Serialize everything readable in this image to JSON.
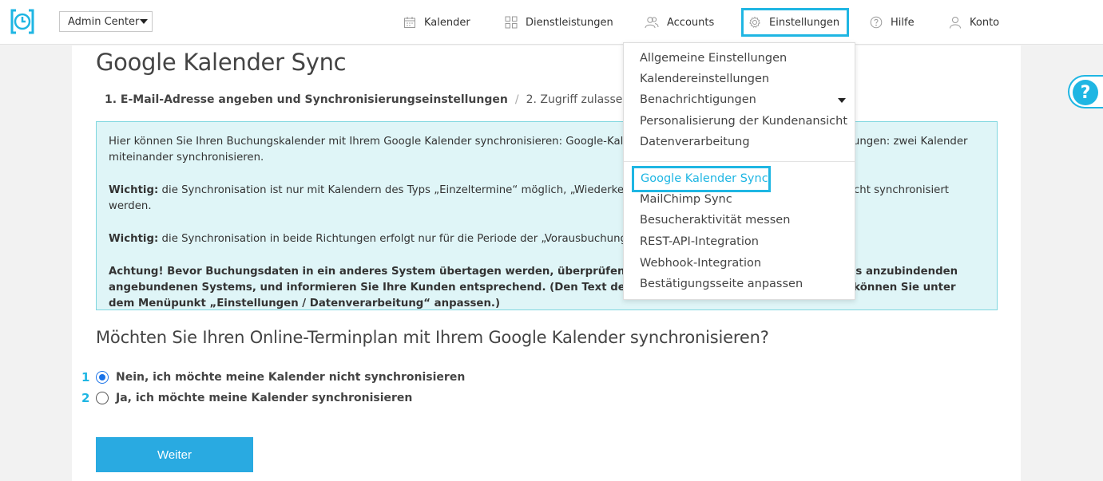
{
  "header": {
    "admin_select": "Admin Center",
    "nav": {
      "kalender": "Kalender",
      "dienstleistungen": "Dienstleistungen",
      "accounts": "Accounts",
      "einstellungen": "Einstellungen",
      "hilfe": "Hilfe",
      "konto": "Konto"
    }
  },
  "page": {
    "title": "Google Kalender Sync",
    "steps": {
      "step1": "1. E-Mail-Adresse angeben und Synchronisierungseinstellungen",
      "separator": "/",
      "step2": "2. Zugriff zulassen"
    },
    "info": {
      "p1": "Hier können Sie Ihren Buchungskalender mit Ihrem Google Kalender synchronisieren: Google-Kalender und Online-Terminplan in beide Richtungen: zwei Kalender miteinander synchronisieren.",
      "p2_label": "Wichtig:",
      "p2": " die Synchronisation ist nur mit Kalendern des Typs „Einzeltermine“ möglich, „Wiederkehrende Kurse“ und andere Typen können nicht synchronisiert werden.",
      "p3_label": "Wichtig:",
      "p3": " die Synchronisation in beide Richtungen erfolgt nur für die Periode der „Vorausbuchungszeit“.",
      "p4": "Achtung! Bevor Buchungsdaten in ein anderes System übertagen werden, überprüfen Sie die Datenschutzbestimmungen des anzubindenden angebundenen Systems, und informieren Sie Ihre Kunden entsprechend. (Den Text der Zustimmung zur Datenverarbeitung können Sie unter dem Menüpunkt „Einstellungen / Datenverarbeitung“ anpassen.)"
    },
    "question": "Möchten Sie Ihren Online-Terminplan mit Ihrem Google Kalender synchronisieren?",
    "options": [
      {
        "number": "1",
        "label": "Nein, ich möchte meine Kalender nicht synchronisieren",
        "checked": true
      },
      {
        "number": "2",
        "label": "Ja, ich möchte meine Kalender synchronisieren",
        "checked": false
      }
    ],
    "button": "Weiter"
  },
  "dropdown": {
    "items": [
      "Allgemeine Einstellungen",
      "Kalendereinstellungen",
      "Benachrichtigungen",
      "Personalisierung der Kundenansicht",
      "Datenverarbeitung"
    ],
    "active": "Google Kalender Sync",
    "items2": [
      "MailChimp Sync",
      "Besucheraktivität messen",
      "REST-API-Integration",
      "Webhook-Integration",
      "Bestätigungsseite anpassen"
    ]
  },
  "help_bubble": "?",
  "colors": {
    "accent": "#1fb6e3",
    "button": "#29aae1",
    "info_bg": "#dff5f7"
  }
}
